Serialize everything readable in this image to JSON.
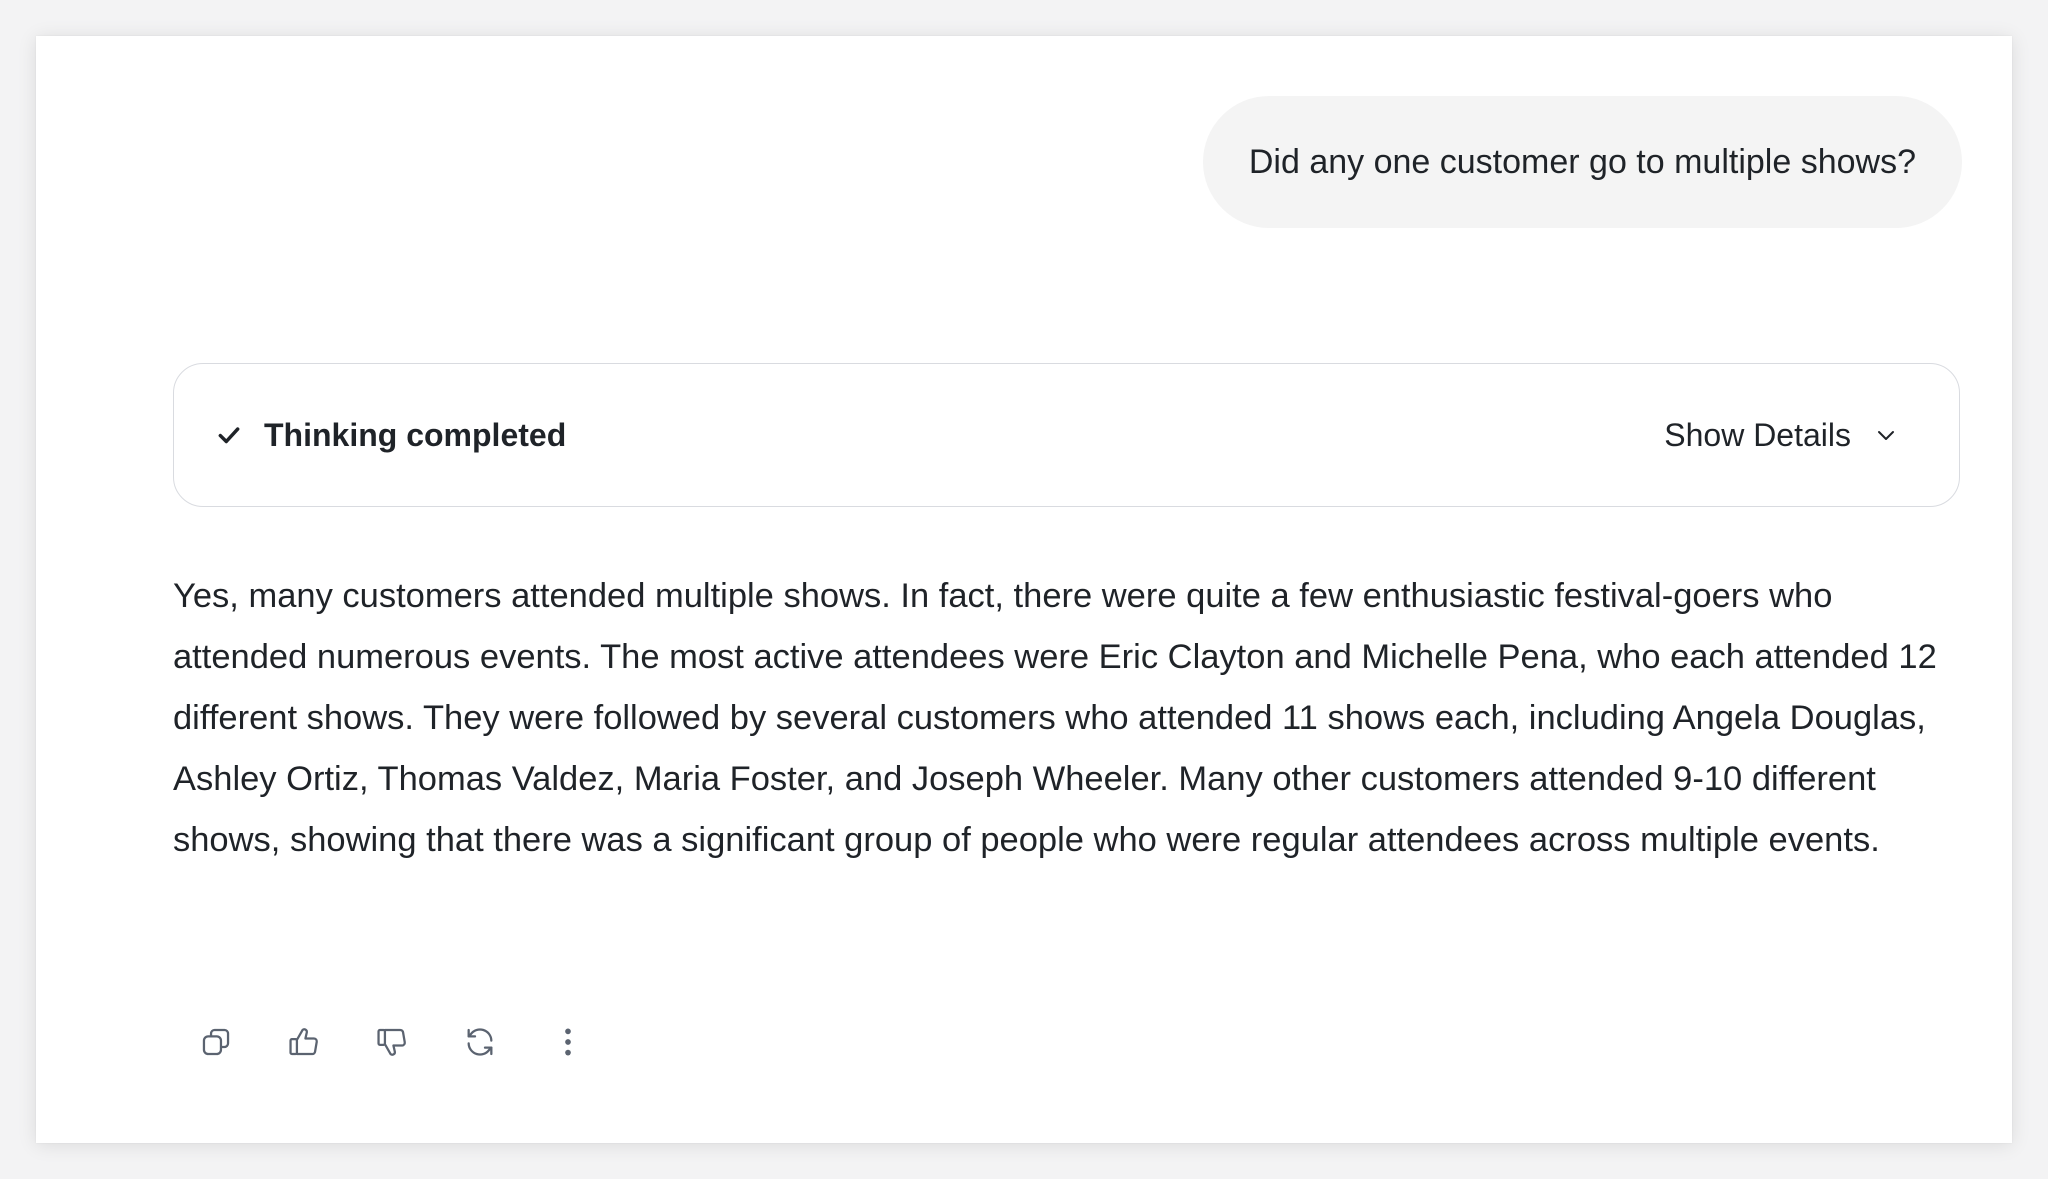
{
  "conversation": {
    "user_message": "Did any one customer go to multiple shows?",
    "thinking": {
      "status_label": "Thinking completed",
      "status_icon": "check-icon",
      "toggle_label": "Show Details",
      "toggle_icon": "chevron-down-icon"
    },
    "assistant_message": "Yes, many customers attended multiple shows. In fact, there were quite a few enthusiastic festival-goers who attended numerous events. The most active attendees were Eric Clayton and Michelle Pena, who each attended 12 different shows. They were followed by several customers who attended 11 shows each, including Angela Douglas, Ashley Ortiz, Thomas Valdez, Maria Foster, and Joseph Wheeler. Many other customers attended 9-10 different shows, showing that there was a significant group of people who were regular attendees across multiple events."
  },
  "actions": [
    {
      "name": "copy",
      "icon": "copy-icon"
    },
    {
      "name": "thumbs-up",
      "icon": "thumbs-up-icon"
    },
    {
      "name": "thumbs-down",
      "icon": "thumbs-down-icon"
    },
    {
      "name": "regenerate",
      "icon": "refresh-icon"
    },
    {
      "name": "more",
      "icon": "more-vertical-icon"
    }
  ],
  "colors": {
    "text": "#1f2328",
    "icon": "#5b6370",
    "bubble_bg": "#f4f4f4",
    "border": "#d9dbe0"
  }
}
